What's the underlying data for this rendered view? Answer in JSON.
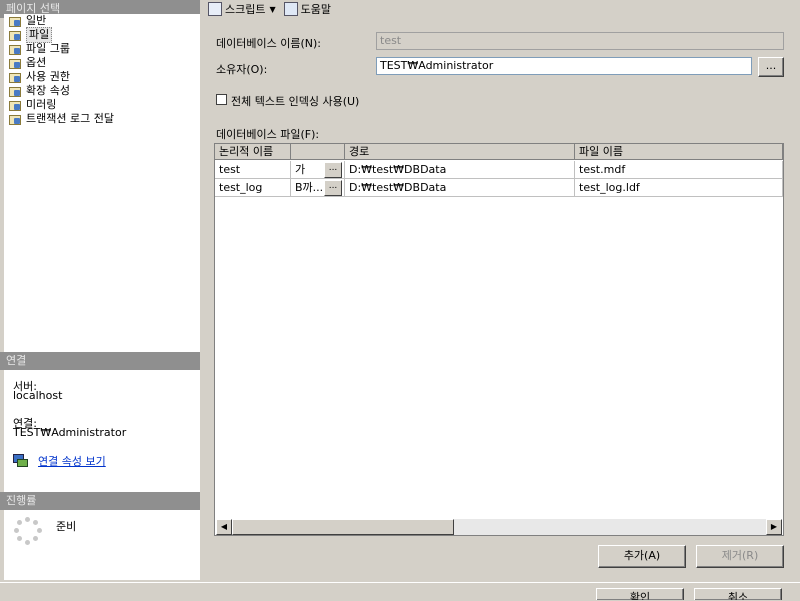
{
  "sidebar": {
    "select_page_header": "페이지 선택",
    "items": [
      {
        "label": "일반"
      },
      {
        "label": "파일"
      },
      {
        "label": "파일 그룹"
      },
      {
        "label": "옵션"
      },
      {
        "label": "사용 권한"
      },
      {
        "label": "확장 속성"
      },
      {
        "label": "미러링"
      },
      {
        "label": "트랜잭션 로그 전달"
      }
    ],
    "selected_index": 1
  },
  "connection": {
    "header": "연결",
    "server_label": "서버:",
    "server_value": "localhost",
    "connection_label": "연결:",
    "connection_value": "TEST₩Administrator",
    "view_props_link": "연결 속성 보기"
  },
  "progress": {
    "header": "진행률",
    "status": "준비"
  },
  "toolbar": {
    "script_label": "스크립트",
    "help_label": "도움말"
  },
  "form": {
    "db_name_label": "데이터베이스 이름(N):",
    "db_name_value": "test",
    "owner_label": "소유자(O):",
    "owner_value": "TEST₩Administrator",
    "browse_label": "...",
    "fulltext_label": "전체 텍스트 인덱싱 사용(U)",
    "fulltext_checked": false,
    "db_files_label": "데이터베이스 파일(F):"
  },
  "grid": {
    "columns": [
      "논리적 이름",
      "",
      "경로",
      "파일 이름"
    ],
    "rows": [
      {
        "logical": "test",
        "growth": "가",
        "path": "D:₩test₩DBData",
        "file": "test.mdf"
      },
      {
        "logical": "test_log",
        "growth": "B까...",
        "path": "D:₩test₩DBData",
        "file": "test_log.ldf"
      }
    ]
  },
  "buttons": {
    "add": "추가(A)",
    "remove": "제거(R)",
    "ok": "확인",
    "cancel": "취소"
  }
}
